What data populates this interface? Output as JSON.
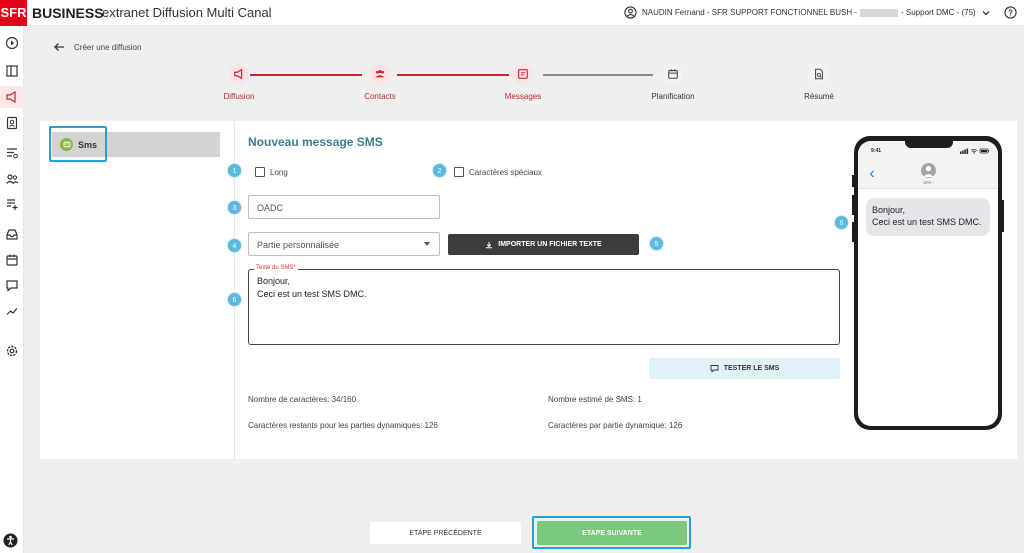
{
  "header": {
    "brand_sfr": "SFR",
    "brand_business": "BUSINESS",
    "app_title": "extranet Diffusion Multi Canal",
    "user_prefix": "NAUDIN Fernand - SFR SUPPORT FONCTIONNEL BUSH -",
    "user_suffix": "- Support DMC - (75)"
  },
  "breadcrumb": {
    "label": "Créer une diffusion"
  },
  "stepper": {
    "steps": [
      {
        "label": "Diffusion",
        "state": "done",
        "icon": "megaphone-icon"
      },
      {
        "label": "Contacts",
        "state": "done",
        "icon": "group-icon"
      },
      {
        "label": "Messages",
        "state": "active",
        "icon": "message-icon"
      },
      {
        "label": "Planification",
        "state": "todo",
        "icon": "calendar-icon"
      },
      {
        "label": "Résumé",
        "state": "todo",
        "icon": "document-search-icon"
      }
    ],
    "color_done": "#c3272f",
    "color_todo": "#8a8a8a"
  },
  "channel_tab": {
    "label": "Sms",
    "icon": "chat-bubble-icon",
    "color": "#8ab543"
  },
  "form": {
    "title": "Nouveau message SMS",
    "long_label": "Long",
    "special_chars_label": "Caractères spéciaux",
    "oadc_placeholder": "OADC",
    "personalized_select": "Partie personnalisée",
    "import_button": "IMPORTER UN FICHIER TEXTE",
    "sms_text_label": "Texte du SMS",
    "sms_text_required": "*",
    "sms_text_line1": "Bonjour,",
    "sms_text_line2": "Ceci est un test SMS DMC.",
    "test_button": "TESTER LE SMS"
  },
  "stats": {
    "chars": "Nombre de caractères: 34/160",
    "estimated_sms": "Nombre estimé de SMS: 1",
    "remaining_dynamic": "Caractères restants pour les parties dynamiques: 126",
    "per_dynamic": "Caractères par partie dynamique: 126"
  },
  "badges": {
    "b1": "1",
    "b2": "2",
    "b3": "3",
    "b4": "4",
    "b5": "5",
    "b6": "6",
    "b6b": "6"
  },
  "phone": {
    "time": "9:41",
    "contact": "SFR ›",
    "message_line1": "Bonjour,",
    "message_line2": "Ceci est un test SMS DMC."
  },
  "footer": {
    "prev_button": "ETAPE PRÉCÉDENTE",
    "next_button": "ETAPE SUIVANTE"
  },
  "colors": {
    "accent_red": "#e2001a",
    "highlight_blue": "#1ea4d9",
    "next_green": "#7ac77d",
    "title_teal": "#3b7d8c"
  }
}
